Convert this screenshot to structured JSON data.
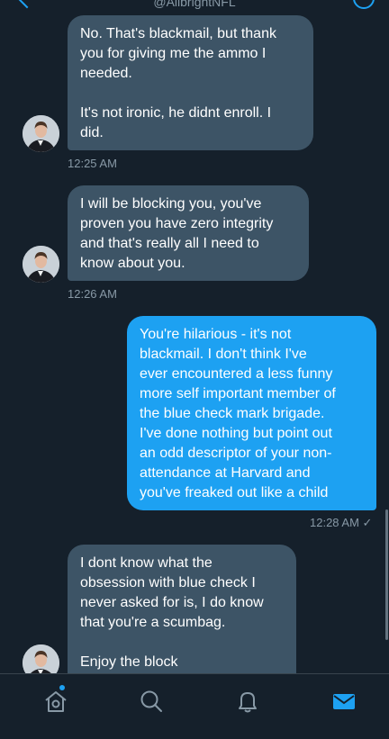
{
  "header": {
    "handle": "@AllbrightNFL"
  },
  "messages": [
    {
      "direction": "in",
      "text": "No. That's blackmail, but thank\nyou for giving me the ammo I\nneeded.\n\nIt's not ironic, he didnt enroll. I\ndid.",
      "time": "12:25 AM"
    },
    {
      "direction": "in",
      "text": "I will be blocking you, you've\nproven you have zero integrity\nand that's really all I need to\nknow about you.",
      "time": "12:26 AM"
    },
    {
      "direction": "out",
      "text": "You're hilarious - it's not\nblackmail. I don't think I've\never encountered a less funny\nmore self important member of\nthe blue check mark brigade.\nI've done nothing but point out\nan odd descriptor of your non-\nattendance at Harvard and\nyou've freaked out like a child",
      "time": "12:28 AM ✓"
    },
    {
      "direction": "in",
      "text": "I dont know what the\nobsession with blue check I\nnever asked for is, I do know\nthat you're a scumbag.\n\nEnjoy the block",
      "time": ""
    }
  ],
  "tabs": [
    {
      "icon": "home-icon"
    },
    {
      "icon": "search-icon"
    },
    {
      "icon": "notifications-icon"
    },
    {
      "icon": "messages-icon"
    }
  ],
  "colors": {
    "background": "#15202b",
    "incoming": "#3d5466",
    "outgoing": "#1da1f2",
    "muted": "#8899a6"
  }
}
